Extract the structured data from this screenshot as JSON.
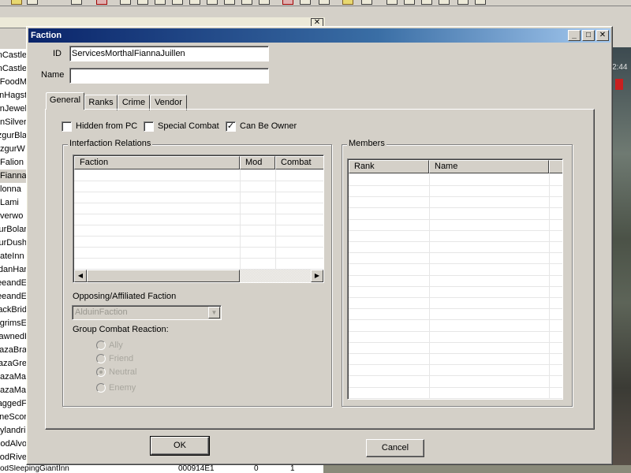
{
  "window": {
    "title": "Faction"
  },
  "form": {
    "id_label": "ID",
    "id_value": "ServicesMorthalFiannaJuillen",
    "name_label": "Name",
    "name_value": ""
  },
  "tabs": [
    {
      "label": "General",
      "active": true
    },
    {
      "label": "Ranks",
      "active": false
    },
    {
      "label": "Crime",
      "active": false
    },
    {
      "label": "Vendor",
      "active": false
    }
  ],
  "general": {
    "checkboxes": [
      {
        "label": "Hidden from PC",
        "checked": false
      },
      {
        "label": "Special Combat",
        "checked": false
      },
      {
        "label": "Can Be Owner",
        "checked": true
      }
    ],
    "interfaction": {
      "title": "Interfaction Relations",
      "columns": [
        "Faction",
        "Mod",
        "Combat"
      ]
    },
    "opposing_label": "Opposing/Affiliated Faction",
    "opposing_value": "AlduinFaction",
    "group_reaction_label": "Group Combat Reaction:",
    "reactions": [
      {
        "label": "Ally",
        "selected": false
      },
      {
        "label": "Friend",
        "selected": false
      },
      {
        "label": "Neutral",
        "selected": true
      },
      {
        "label": "Enemy",
        "selected": false
      }
    ],
    "members": {
      "title": "Members",
      "columns": [
        "Rank",
        "Name"
      ]
    }
  },
  "buttons": {
    "ok": "OK",
    "cancel": "Cancel"
  },
  "background": {
    "list_items": [
      "nCastle",
      "nCastle",
      "nFoodM",
      "nHagst",
      "nJewel",
      "nSilver",
      "zgurBla",
      "zgurW",
      "Falion",
      "Fianna",
      "lonna",
      "Lami",
      "verwo",
      "urBolar",
      "urDush",
      "ateInn",
      "danHar",
      "eeandE",
      "eeandE",
      "ackBrid",
      "grimsE",
      "awnedI",
      "azaBra",
      "azaGre",
      "azaMa",
      "azaMa",
      "aggedF",
      "neScor",
      "ylandri",
      "oodAlvo",
      "oodRive"
    ],
    "selected_index": 9,
    "bottom_row": [
      "odSleepingGiantInn",
      "000914E1",
      "0",
      "1"
    ],
    "clock": "2:44",
    "close_glyph": "✕"
  }
}
